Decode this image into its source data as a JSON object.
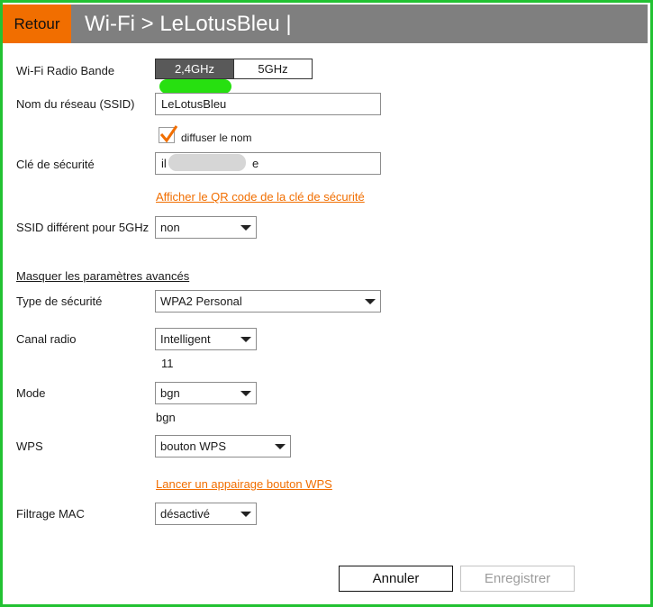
{
  "header": {
    "back_label": "Retour",
    "title": "Wi-Fi > LeLotusBleu |"
  },
  "colors": {
    "accent": "#f16e00",
    "header_bg": "#7f7f7f",
    "frame": "#22c232",
    "segment_active": "#595959"
  },
  "form": {
    "band": {
      "label": "Wi-Fi Radio Bande",
      "options": [
        "2,4GHz",
        "5GHz"
      ],
      "selected": "2,4GHz"
    },
    "ssid": {
      "label": "Nom du réseau (SSID)",
      "value": "LeLotusBleu"
    },
    "broadcast": {
      "label": "diffuser le nom",
      "checked": true
    },
    "security_key": {
      "label": "Clé de sécurité",
      "value_start": "il",
      "value_end": "e"
    },
    "qr_link": "Afficher le QR code de la clé de sécurité",
    "ssid_5ghz": {
      "label": "SSID différent pour 5GHz",
      "value": "non"
    },
    "advanced_link": "Masquer les paramètres avancés",
    "security_type": {
      "label": "Type de sécurité",
      "value": "WPA2 Personal"
    },
    "channel": {
      "label": "Canal radio",
      "value": "Intelligent",
      "current": "11"
    },
    "mode": {
      "label": "Mode",
      "value": "bgn",
      "current": "bgn"
    },
    "wps": {
      "label": "WPS",
      "value": "bouton WPS",
      "link": "Lancer un appairage bouton WPS"
    },
    "mac_filter": {
      "label": "Filtrage MAC",
      "value": "désactivé"
    }
  },
  "actions": {
    "cancel_label": "Annuler",
    "save_label": "Enregistrer"
  }
}
